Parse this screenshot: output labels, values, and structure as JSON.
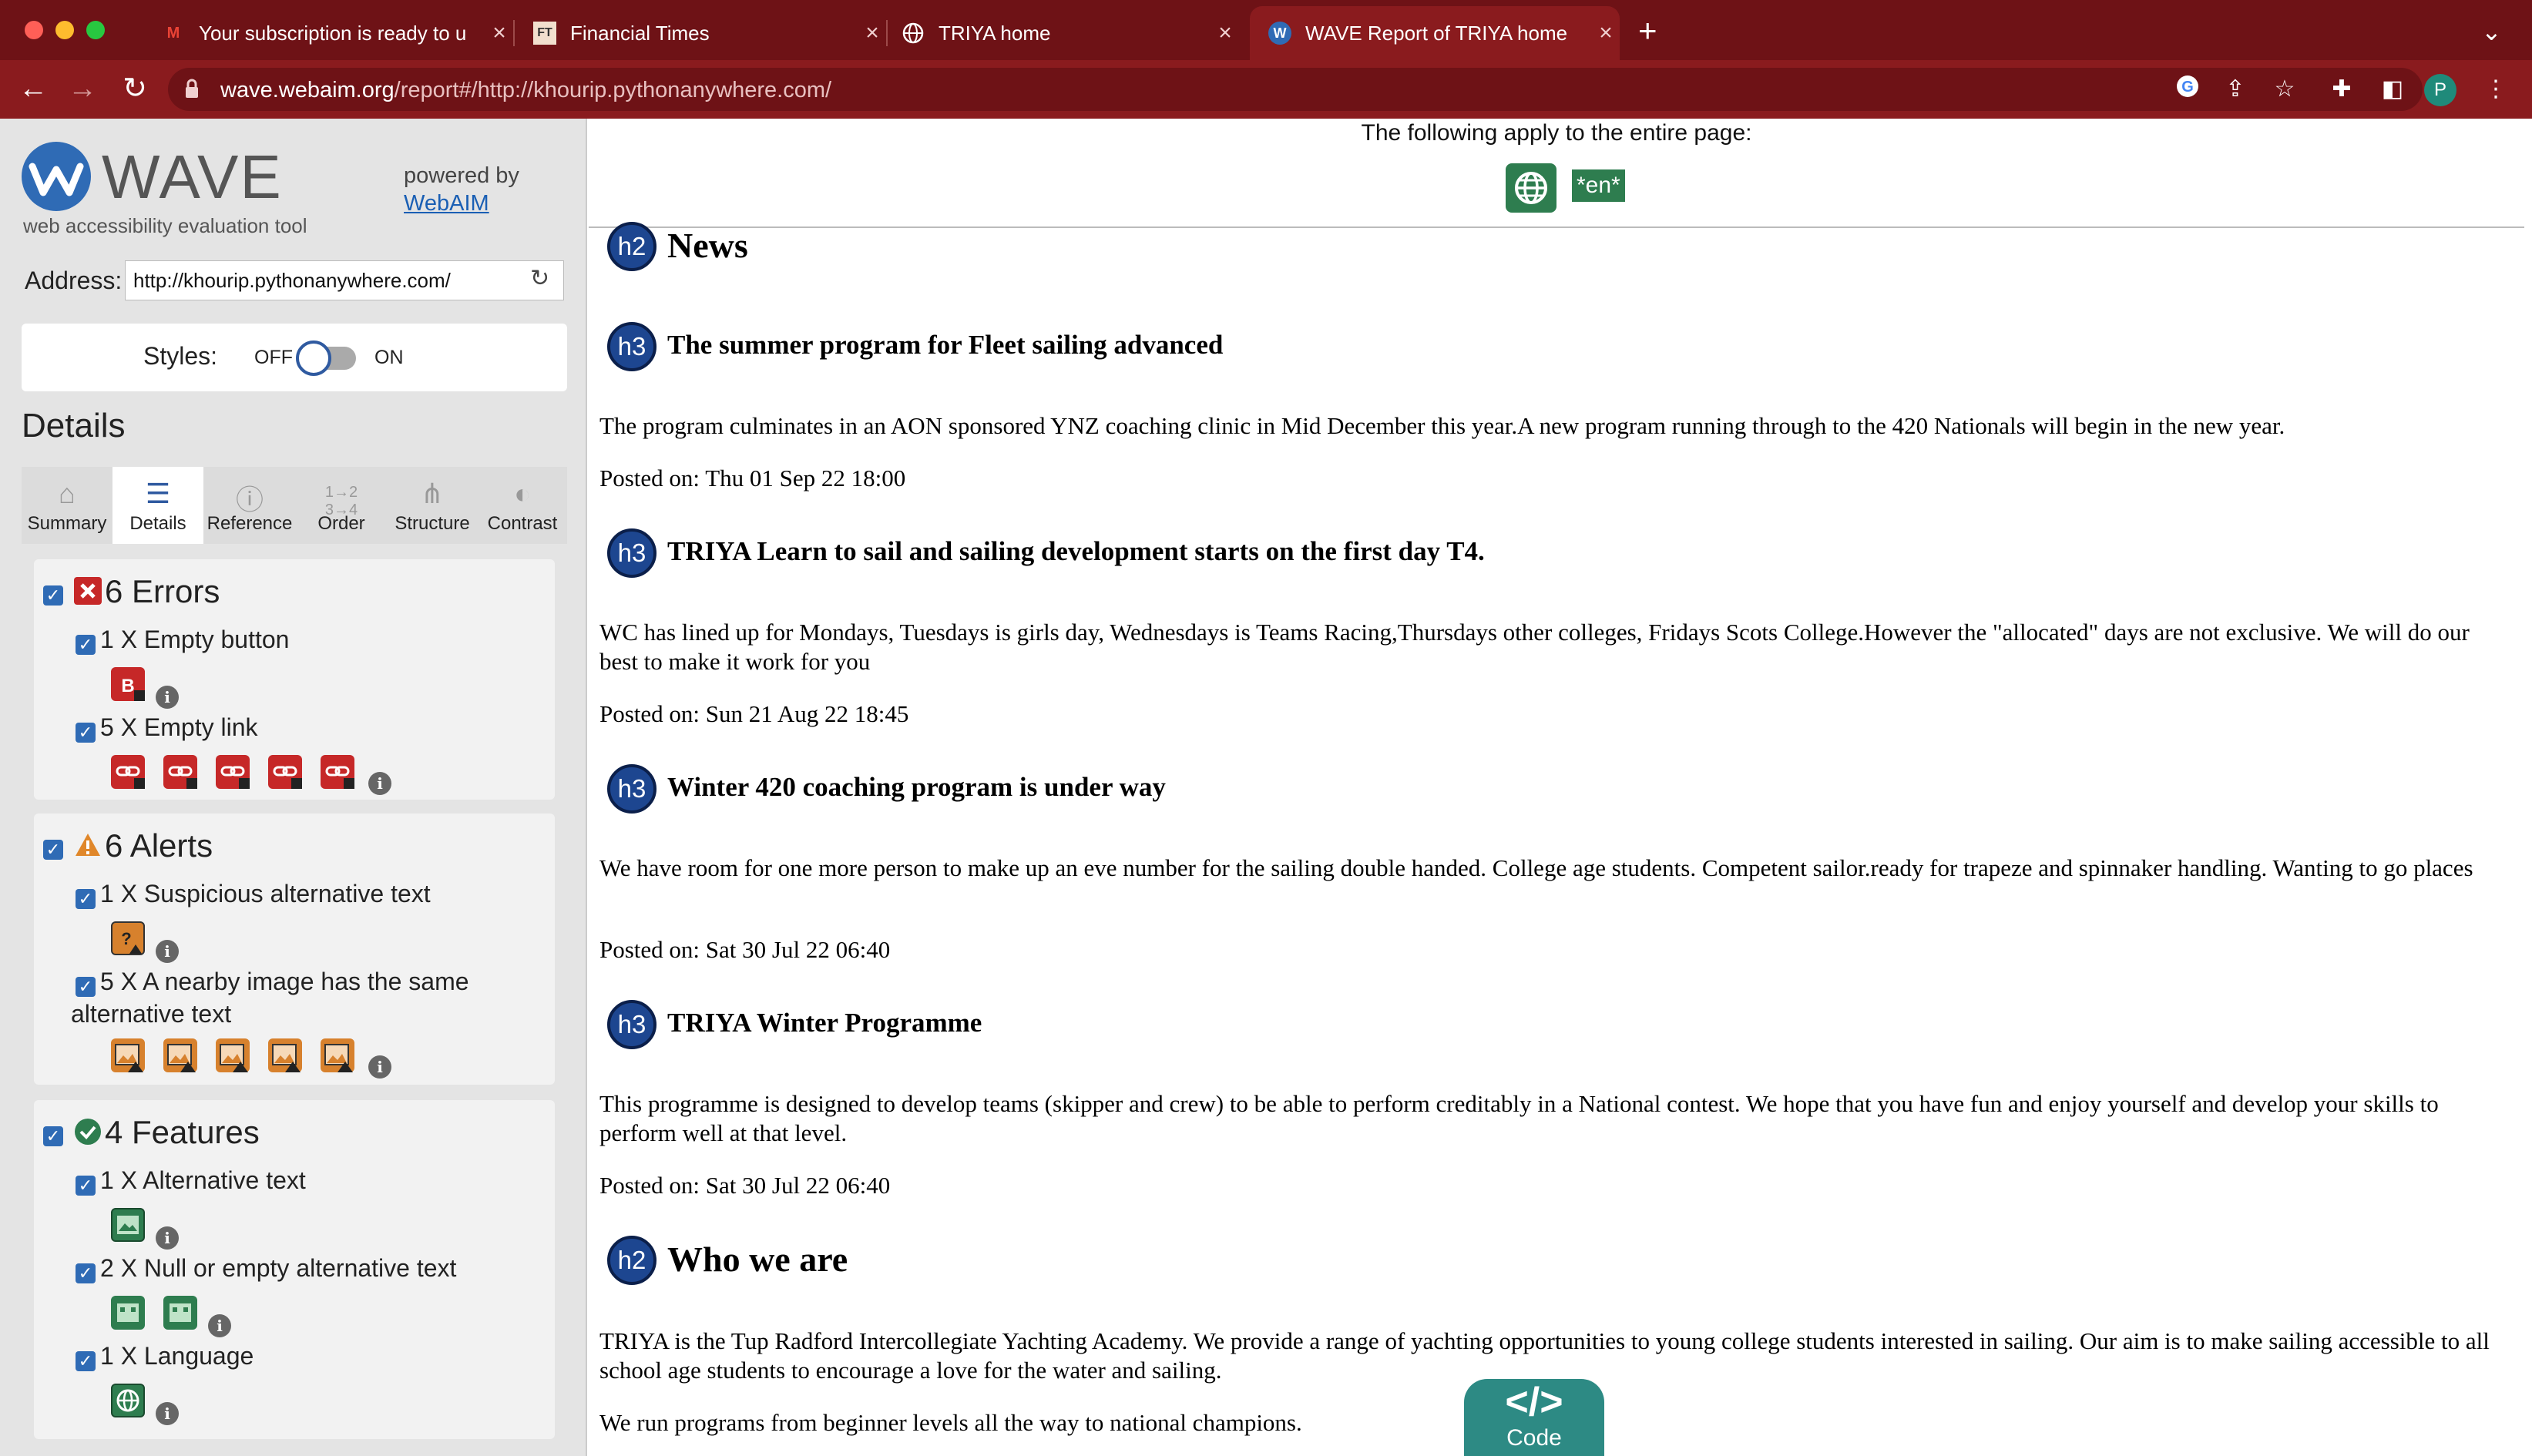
{
  "browser": {
    "tabs": [
      {
        "title": "Your subscription is ready to u",
        "icon": "gmail-icon"
      },
      {
        "title": "Financial Times",
        "icon": "ft-icon"
      },
      {
        "title": "TRIYA home",
        "icon": "globe-icon"
      },
      {
        "title": "WAVE Report of TRIYA home",
        "icon": "wave-icon"
      }
    ],
    "url_host": "wave.webaim.org",
    "url_path": "/report#/http://khourip.pythonanywhere.com/",
    "profile_initial": "P"
  },
  "sidebar": {
    "logo_text": "WAVE",
    "logo_sub": "web accessibility evaluation tool",
    "powered_by": "powered by",
    "webaim_link": "WebAIM",
    "address_label": "Address:",
    "address_value": "http://khourip.pythonanywhere.com/",
    "styles_label": "Styles:",
    "styles_off": "OFF",
    "styles_on": "ON",
    "details_heading": "Details",
    "tabs": [
      "Summary",
      "Details",
      "Reference",
      "Order",
      "Structure",
      "Contrast"
    ],
    "errors": {
      "title": "6 Errors",
      "items": [
        {
          "label": "1 X Empty button",
          "count": 1
        },
        {
          "label": "5 X Empty link",
          "count": 5
        }
      ]
    },
    "alerts": {
      "title": "6 Alerts",
      "items": [
        {
          "label": "1 X Suspicious alternative text",
          "count": 1
        },
        {
          "label": "5 X A nearby image has the same",
          "label2": "alternative text",
          "count": 5
        }
      ]
    },
    "features": {
      "title": "4 Features",
      "items": [
        {
          "label": "1 X Alternative text",
          "count": 1
        },
        {
          "label": "2 X Null or empty alternative text",
          "count": 2
        },
        {
          "label": "1 X Language",
          "count": 1
        }
      ]
    }
  },
  "main": {
    "banner_text": "The following apply to the entire page:",
    "lang_tag": "*en*",
    "headings": [
      {
        "level": "h2",
        "text": "News"
      },
      {
        "level": "h3",
        "text": "The summer program for Fleet sailing advanced"
      },
      {
        "level": "h3",
        "text": "TRIYA Learn to sail and sailing development starts on the first day T4."
      },
      {
        "level": "h3",
        "text": "Winter 420 coaching program is under way"
      },
      {
        "level": "h3",
        "text": "TRIYA Winter Programme"
      },
      {
        "level": "h2",
        "text": "Who we are"
      }
    ],
    "paragraphs": [
      "The program culminates in an AON sponsored YNZ coaching clinic in Mid December this year.A new program running through to the 420 Nationals will begin in the new year.",
      "Posted on: Thu 01 Sep 22 18:00",
      "WC has lined up for Mondays, Tuesdays is girls day, Wednesdays is Teams Racing,Thursdays other colleges, Fridays Scots College.However the \"allocated\" days are not exclusive. We will do our best to make it work for you",
      "Posted on: Sun 21 Aug 22 18:45",
      "We have room for one more person to make up an eve number for the sailing double handed. College age students. Competent sailor.ready for trapeze and spinnaker handling. Wanting to go places",
      "Posted on: Sat 30 Jul 22 06:40",
      "This programme is designed to develop teams (skipper and crew) to be able to perform creditably in a National contest. We hope that you have fun and enjoy yourself and develop your skills to perform well at that level.",
      "Posted on: Sat 30 Jul 22 06:40",
      "TRIYA is the Tup Radford Intercollegiate Yachting Academy. We provide a range of yachting opportunities to young college students interested in sailing. Our aim is to make sailing accessible to all school age students to encourage a love for the water and sailing.",
      "We run programs from beginner levels all the way to national champions."
    ],
    "code_button": "Code"
  },
  "colors": {
    "tabstrip": "#6e1216",
    "toolbar": "#8a1b1e",
    "error": "#c62828",
    "alert": "#e0872a",
    "feature": "#2e7d4f",
    "heading_badge": "#1d4690"
  }
}
